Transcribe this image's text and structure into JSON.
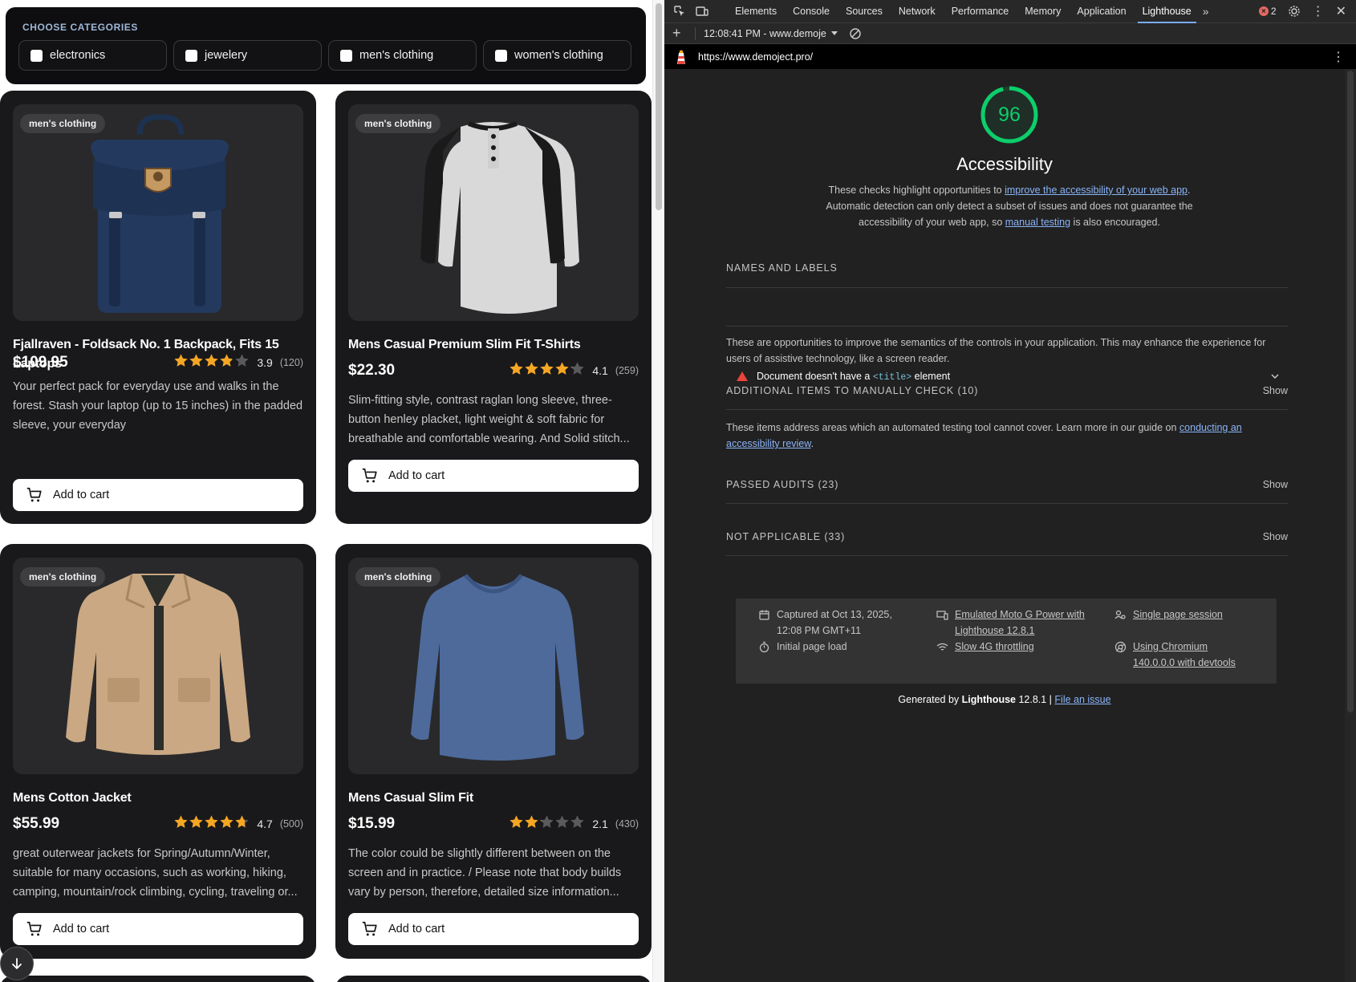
{
  "store": {
    "categories_title": "CHOOSE CATEGORIES",
    "categories": [
      "electronics",
      "jewelery",
      "men's clothing",
      "women's clothing"
    ],
    "products": [
      {
        "tag": "men's clothing",
        "title": "Fjallraven - Foldsack No. 1 Backpack, Fits 15 Laptops",
        "price": "$109.95",
        "rating": "3.9",
        "rating_value": 3.9,
        "count": "(120)",
        "description": "Your perfect pack for everyday use and walks in the forest. Stash your laptop (up to 15 inches) in the padded sleeve, your everyday",
        "cart_label": "Add to cart",
        "image": "backpack"
      },
      {
        "tag": "men's clothing",
        "title": "Mens Casual Premium Slim Fit T-Shirts",
        "price": "$22.30",
        "rating": "4.1",
        "rating_value": 4.1,
        "count": "(259)",
        "description": "Slim-fitting style, contrast raglan long sleeve, three-button henley placket, light weight & soft fabric for breathable and comfortable wearing. And Solid stitch...",
        "cart_label": "Add to cart",
        "image": "henley-tshirt"
      },
      {
        "tag": "men's clothing",
        "title": "Mens Cotton Jacket",
        "price": "$55.99",
        "rating": "4.7",
        "rating_value": 4.7,
        "count": "(500)",
        "description": "great outerwear jackets for Spring/Autumn/Winter, suitable for many occasions, such as working, hiking, camping, mountain/rock climbing, cycling, traveling or...",
        "cart_label": "Add to cart",
        "image": "cotton-jacket"
      },
      {
        "tag": "men's clothing",
        "title": "Mens Casual Slim Fit",
        "price": "$15.99",
        "rating": "2.1",
        "rating_value": 2.1,
        "count": "(430)",
        "description": "The color could be slightly different between on the screen and in practice. / Please note that body builds vary by person, therefore, detailed size information...",
        "cart_label": "Add to cart",
        "image": "long-sleeve-tee"
      }
    ]
  },
  "devtools": {
    "tabs": [
      "Elements",
      "Console",
      "Sources",
      "Network",
      "Performance",
      "Memory",
      "Application",
      "Lighthouse"
    ],
    "active_tab": "Lighthouse",
    "error_count": "2",
    "report_label": "12:08:41 PM - www.demoje",
    "url": "https://www.demoject.pro/",
    "lighthouse": {
      "score": "96",
      "score_value": 96,
      "category": "Accessibility",
      "desc_1": "These checks highlight opportunities to ",
      "desc_link_1": "improve the accessibility of your web app",
      "desc_2": ". Automatic detection can only detect a subset of issues and does not guarantee the accessibility of your web app, so ",
      "desc_link_2": "manual testing",
      "desc_3": " is also encouraged.",
      "names_labels": "NAMES AND LABELS",
      "audit_pre": "Document doesn't have a ",
      "audit_code": "<title>",
      "audit_post": " element",
      "names_desc": "These are opportunities to improve the semantics of the controls in your application. This may enhance the experience for users of assistive technology, like a screen reader.",
      "manual_title": "ADDITIONAL ITEMS TO MANUALLY CHECK (10)",
      "manual_desc_pre": "These items address areas which an automated testing tool cannot cover. Learn more in our guide on ",
      "manual_desc_link": "conducting an accessibility review",
      "manual_desc_post": ".",
      "passed_title": "PASSED AUDITS (23)",
      "na_title": "NOT APPLICABLE (33)",
      "show_label": "Show",
      "env": {
        "captured": "Captured at Oct 13, 2025, 12:08 PM GMT+11",
        "load": "Initial page load",
        "device": "Emulated Moto G Power with Lighthouse 12.8.1",
        "throttle": "Slow 4G throttling",
        "session": "Single page session",
        "browser": "Using Chromium 140.0.0.0 with devtools"
      },
      "footer_pre": "Generated by ",
      "footer_brand": "Lighthouse",
      "footer_version": " 12.8.1 | ",
      "footer_link": "File an issue"
    }
  },
  "colors": {
    "gauge_green": "#0cce6b",
    "star_gold": "#f5a623",
    "star_empty": "#5a5a5c",
    "link_blue": "#8ab4f8",
    "fail_red": "#e8453c"
  }
}
